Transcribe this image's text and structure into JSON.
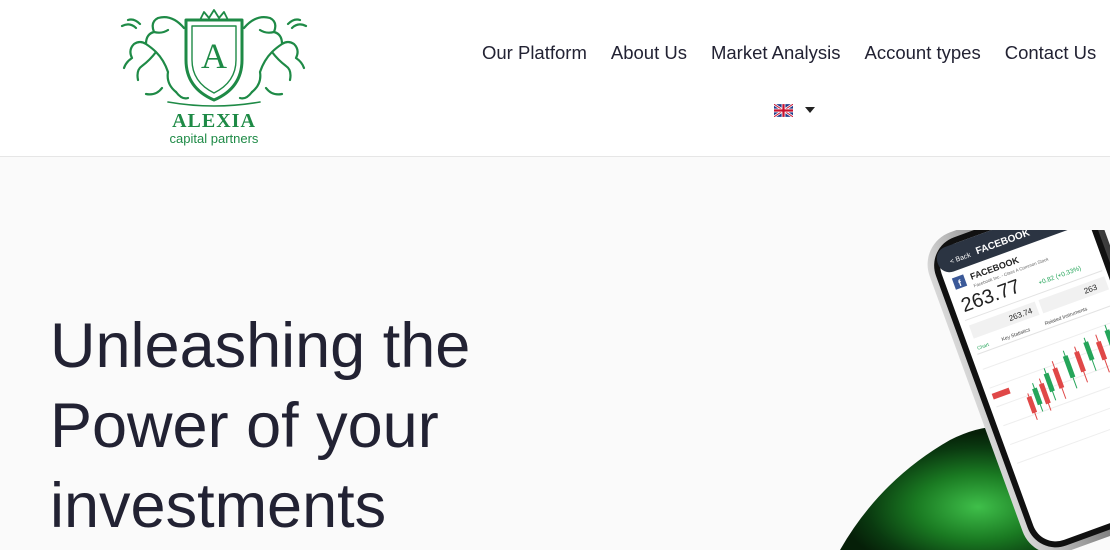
{
  "brand": {
    "logo_letter": "A",
    "name": "ALEXIA",
    "tagline": "capital partners",
    "color": "#1e8a46"
  },
  "nav": {
    "items": [
      "Our Platform",
      "About Us",
      "Market Analysis",
      "Account types",
      "Contact Us"
    ]
  },
  "language": {
    "flag_icon": "uk-flag-icon",
    "dropdown_icon": "caret-down-icon"
  },
  "hero": {
    "title_lines": [
      "Unleashing the",
      "Power of your",
      "investments"
    ]
  },
  "phone": {
    "back_label": "< Back",
    "ticker": "FACEBOOK",
    "company": "Facebook Inc. - Class A Common Stock",
    "price": "263.77",
    "change": "+0.82 (+0.33%)",
    "bid": "263.74",
    "ask": "263",
    "tabs": [
      "Chart",
      "Key Statistics",
      "Related Instruments"
    ],
    "chart_colors": {
      "up": "#25a55a",
      "down": "#e04848"
    }
  }
}
